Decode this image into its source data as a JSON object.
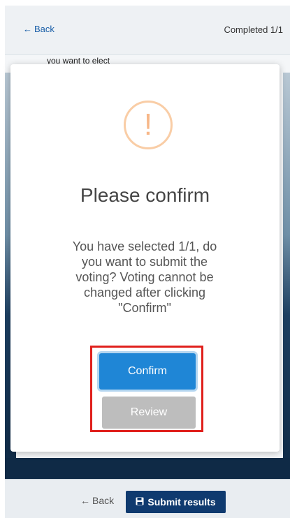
{
  "header": {
    "back_label": "Back",
    "completed_text": "Completed 1/1"
  },
  "page": {
    "subtitle": "you want to elect"
  },
  "modal": {
    "icon": "!",
    "title": "Please confirm",
    "message": "You have selected 1/1, do you want to submit the voting? Voting cannot be changed after clicking \"Confirm\"",
    "confirm_label": "Confirm",
    "review_label": "Review"
  },
  "footer": {
    "back_label": "Back",
    "submit_label": "Submit results"
  },
  "colors": {
    "accent": "#1f86d6",
    "submit": "#0f3a6f",
    "warning": "#f9cda6",
    "highlight": "#e0201c"
  },
  "icons": [
    "arrow-left-icon",
    "save-icon",
    "exclamation-icon"
  ]
}
